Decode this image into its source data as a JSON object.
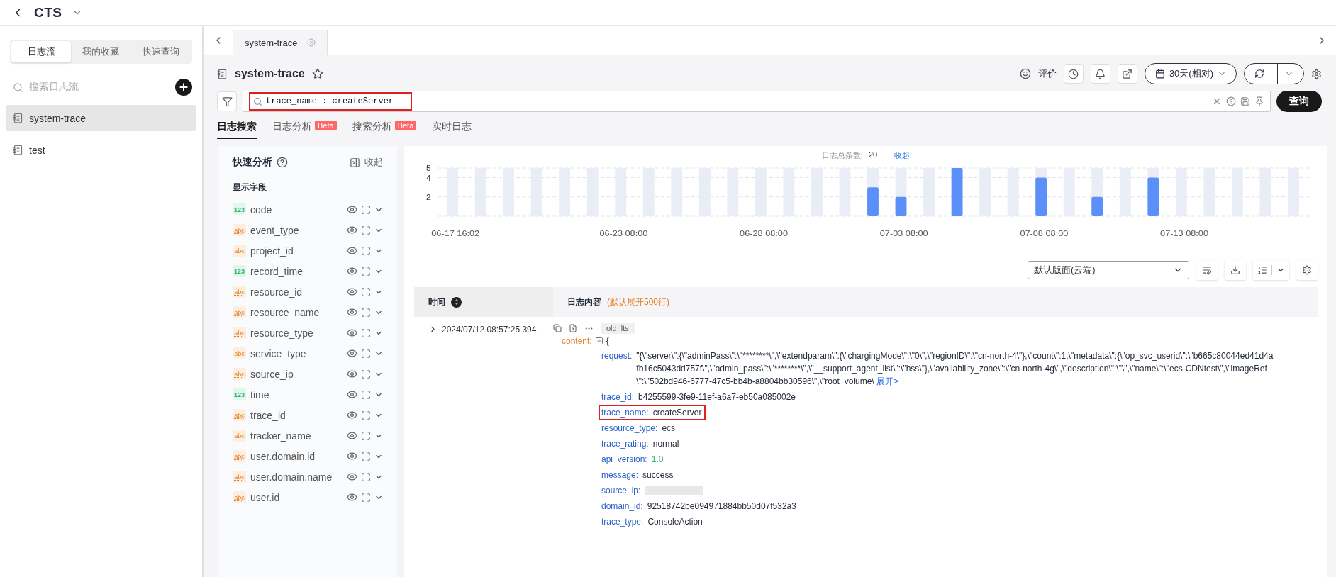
{
  "app": {
    "title": "CTS"
  },
  "sidebar": {
    "tabs": [
      {
        "label": "日志流",
        "selected": true
      },
      {
        "label": "我的收藏",
        "selected": false
      },
      {
        "label": "快速查询",
        "selected": false
      }
    ],
    "search": {
      "placeholder": "搜索日志流"
    },
    "items": [
      {
        "label": "system-trace",
        "selected": true
      },
      {
        "label": "test",
        "selected": false
      }
    ]
  },
  "tab_bar": {
    "tabs": [
      {
        "label": "system-trace"
      }
    ]
  },
  "header": {
    "title": "system-trace",
    "feedback": "评价",
    "time_range": "30天(相对)"
  },
  "query": {
    "value": "trace_name : createServer",
    "highlighted": true,
    "submit": "查询"
  },
  "analysis_tabs": [
    {
      "label": "日志搜索",
      "selected": true
    },
    {
      "label": "日志分析",
      "badge": "Beta",
      "selected": false
    },
    {
      "label": "搜索分析",
      "badge": "Beta",
      "selected": false
    },
    {
      "label": "实时日志",
      "selected": false
    }
  ],
  "quick_analysis": {
    "title": "快速分析",
    "collapse": "收起",
    "section": "显示字段",
    "fields": [
      {
        "type": "123",
        "kind": "number",
        "name": "code"
      },
      {
        "type": "abc",
        "kind": "string",
        "name": "event_type"
      },
      {
        "type": "abc",
        "kind": "string",
        "name": "project_id"
      },
      {
        "type": "123",
        "kind": "number",
        "name": "record_time"
      },
      {
        "type": "abc",
        "kind": "string",
        "name": "resource_id"
      },
      {
        "type": "abc",
        "kind": "string",
        "name": "resource_name"
      },
      {
        "type": "abc",
        "kind": "string",
        "name": "resource_type"
      },
      {
        "type": "abc",
        "kind": "string",
        "name": "service_type"
      },
      {
        "type": "abc",
        "kind": "string",
        "name": "source_ip"
      },
      {
        "type": "123",
        "kind": "number",
        "name": "time"
      },
      {
        "type": "abc",
        "kind": "string",
        "name": "trace_id"
      },
      {
        "type": "abc",
        "kind": "string",
        "name": "tracker_name"
      },
      {
        "type": "abc",
        "kind": "string",
        "name": "user.domain.id"
      },
      {
        "type": "abc",
        "kind": "string",
        "name": "user.domain.name"
      },
      {
        "type": "abc",
        "kind": "string",
        "name": "user.id"
      }
    ]
  },
  "histogram": {
    "total_label": "日志总条数:",
    "total": "20",
    "collapse": "收起",
    "chart_data": {
      "type": "bar",
      "categories": [
        "06-17 16:02",
        null,
        null,
        null,
        null,
        null,
        "06-23 08:00",
        null,
        null,
        null,
        null,
        "06-28 08:00",
        null,
        null,
        null,
        null,
        "07-03 08:00",
        null,
        null,
        null,
        null,
        "07-08 08:00",
        null,
        null,
        null,
        null,
        "07-13 08:00",
        null,
        null,
        null,
        null
      ],
      "series": [
        {
          "color": "#5b8ff9",
          "values": [
            0,
            0,
            0,
            0,
            0,
            0,
            0,
            0,
            0,
            0,
            0,
            0,
            0,
            0,
            0,
            3,
            2,
            0,
            5,
            0,
            0,
            4,
            0,
            2,
            0,
            4,
            0,
            0,
            0,
            0,
            0
          ]
        }
      ],
      "ylim": [
        0,
        5
      ],
      "yticks": [
        2,
        4,
        5
      ],
      "grid": true
    }
  },
  "layout_select": {
    "value": "默认版面(云端)"
  },
  "table": {
    "columns": [
      {
        "label": "时间"
      },
      {
        "label": "日志内容",
        "note": "(默认展开500行)"
      }
    ],
    "rows": [
      {
        "time": "2024/07/12 08:57:25.394",
        "tag": "old_lts",
        "root_key": "content:",
        "root_open": "{",
        "fields": [
          {
            "key": "request:",
            "kind": "long",
            "value": "\"{\\\"server\\\":{\\\"adminPass\\\":\\\"********\\\",\\\"extendparam\\\":{\\\"chargingMode\\\":\\\"0\\\",\\\"regionID\\\":\\\"cn-north-4\\\"},\\\"count\\\":1,\\\"metadata\\\":{\\\"op_svc_userid\\\":\\\"b665c80044ed41d4afb16c5043dd757f\\\",\\\"admin_pass\\\":\\\"********\\\",\\\"__support_agent_list\\\":\\\"hss\\\"},\\\"availability_zone\\\":\\\"cn-north-4g\\\",\\\"description\\\":\\\"\\\",\\\"name\\\":\\\"ecs-CDNtest\\\",\\\"imageRef\\\":\\\"502bd946-6777-47c5-bb4b-a8804bb30596\\\",\\\"root_volume\\",
            "link": "展开>",
            "highlighted": false
          },
          {
            "key": "trace_id:",
            "kind": "text",
            "value": "b4255599-3fe9-11ef-a6a7-eb50a085002e",
            "highlighted": false
          },
          {
            "key": "trace_name:",
            "kind": "text",
            "value": "createServer",
            "highlighted": true
          },
          {
            "key": "resource_type:",
            "kind": "text",
            "value": "ecs",
            "highlighted": false
          },
          {
            "key": "trace_rating:",
            "kind": "text",
            "value": "normal",
            "highlighted": false
          },
          {
            "key": "api_version:",
            "kind": "number",
            "value": "1.0",
            "highlighted": false
          },
          {
            "key": "message:",
            "kind": "text",
            "value": "success",
            "highlighted": false
          },
          {
            "key": "source_ip:",
            "kind": "masked",
            "highlighted": false
          },
          {
            "key": "domain_id:",
            "kind": "text",
            "value": "92518742be094971884bb50d07f532a3",
            "highlighted": false
          },
          {
            "key": "trace_type:",
            "kind": "text",
            "value": "ConsoleAction",
            "highlighted": false
          }
        ]
      }
    ]
  }
}
